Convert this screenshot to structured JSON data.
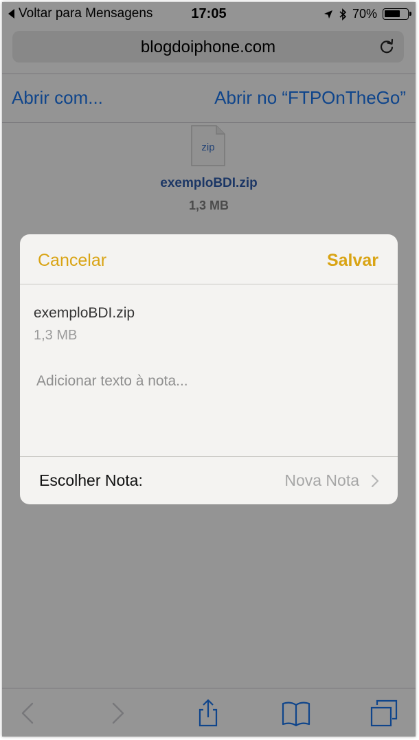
{
  "status_bar": {
    "back_label": "Voltar para Mensagens",
    "time": "17:05",
    "battery": "70%",
    "battery_level": 0.7
  },
  "address_bar": {
    "url": "blogdoiphone.com"
  },
  "actions": {
    "open_with": "Abrir com...",
    "open_in": "Abrir no “FTPOnTheGo”"
  },
  "file": {
    "icon_label": "zip",
    "name": "exemploBDI.zip",
    "size": "1,3 MB"
  },
  "notes_sheet": {
    "cancel_label": "Cancelar",
    "save_label": "Salvar",
    "attachment_name": "exemploBDI.zip",
    "attachment_size": "1,3 MB",
    "note_placeholder": "Adicionar texto à nota...",
    "choose_note_label": "Escolher Nota:",
    "choose_note_value": "Nova Nota"
  },
  "colors": {
    "link_blue": "#1a73e8",
    "notes_accent": "#d9a415",
    "toolbar_blue": "#1a73e8"
  },
  "icons": [
    "back-chevron-icon",
    "forward-chevron-icon",
    "share-icon",
    "bookmarks-icon",
    "tabs-icon",
    "reload-icon",
    "location-icon",
    "bluetooth-icon",
    "battery-icon",
    "zip-file-icon",
    "chevron-right-icon"
  ]
}
